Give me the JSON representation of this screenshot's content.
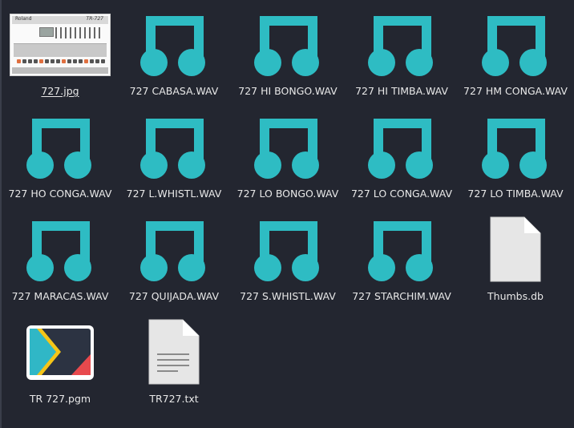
{
  "files": [
    {
      "name": "727.jpg",
      "type": "image-thumbnail",
      "selected": true
    },
    {
      "name": "727 CABASA.WAV",
      "type": "audio-file"
    },
    {
      "name": "727 HI BONGO.WAV",
      "type": "audio-file"
    },
    {
      "name": "727 HI TIMBA.WAV",
      "type": "audio-file"
    },
    {
      "name": "727 HM CONGA.WAV",
      "type": "audio-file"
    },
    {
      "name": "727 HO CONGA.WAV",
      "type": "audio-file"
    },
    {
      "name": "727 L.WHISTL.WAV",
      "type": "audio-file"
    },
    {
      "name": "727 LO BONGO.WAV",
      "type": "audio-file"
    },
    {
      "name": "727 LO CONGA.WAV",
      "type": "audio-file"
    },
    {
      "name": "727 LO TIMBA.WAV",
      "type": "audio-file"
    },
    {
      "name": "727 MARACAS.WAV",
      "type": "audio-file"
    },
    {
      "name": "727 QUIJADA.WAV",
      "type": "audio-file"
    },
    {
      "name": "727 S.WHISTL.WAV",
      "type": "audio-file"
    },
    {
      "name": "727 STARCHIM.WAV",
      "type": "audio-file"
    },
    {
      "name": "Thumbs.db",
      "type": "blank-document"
    },
    {
      "name": "TR 727.pgm",
      "type": "image-viewer-app"
    },
    {
      "name": "TR727.txt",
      "type": "text-document"
    }
  ],
  "thumbnail": {
    "brand": "Roland",
    "model": "TR-727"
  },
  "colors": {
    "background": "#232630",
    "audio_icon": "#2ebcc3",
    "label_text": "#e8e8e8",
    "document": "#e6e6e6"
  }
}
